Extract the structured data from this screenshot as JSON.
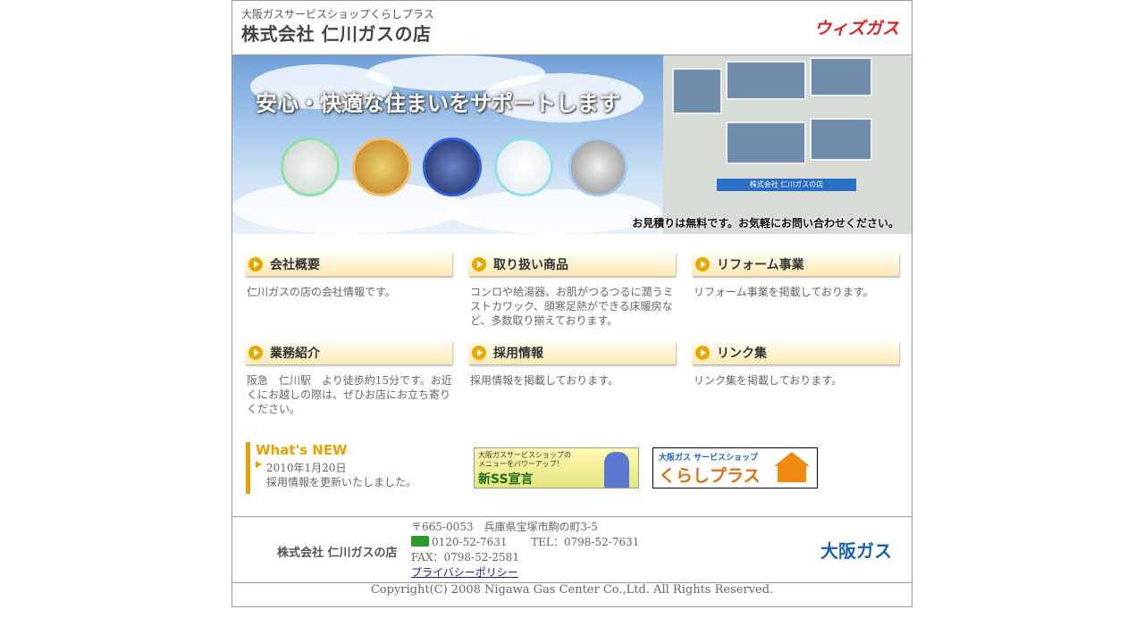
{
  "header": {
    "subtitle": "大阪ガスサービスショップくらしプラス",
    "title": "株式会社 仁川ガスの店",
    "brand": "ウィズガス"
  },
  "hero": {
    "headline": "安心・快適な住まいをサポートします",
    "caption": "お見積りは無料です。お気軽にお問い合わせください。",
    "shop_sign": "株式会社 仁川ガスの店"
  },
  "menu": [
    {
      "label": "会社概要",
      "desc": "仁川ガスの店の会社情報です。"
    },
    {
      "label": "取り扱い商品",
      "desc": "コンロや給湯器、お肌がつるつるに潤うミストカワック、頭寒足熱ができる床暖房など、多数取り揃えております。"
    },
    {
      "label": "リフォーム事業",
      "desc": "リフォーム事業を掲載しております。"
    },
    {
      "label": "業務紹介",
      "desc": "阪急　仁川駅　より徒歩約15分です。お近くにお越しの際は、ぜひお店にお立ち寄りください。"
    },
    {
      "label": "採用情報",
      "desc": "採用情報を掲載しております。"
    },
    {
      "label": "リンク集",
      "desc": "リンク集を掲載しております。"
    }
  ],
  "news": {
    "title": "What's NEW",
    "date": "2010年1月20日",
    "text": "採用情報を更新いたしました。"
  },
  "banners": {
    "ss": {
      "line1": "大阪ガスサービスショップの",
      "line2": "メニューをパワーアップ！",
      "line3": "新SS宣言"
    },
    "kurashi": {
      "line1": "大阪ガス サービスショップ",
      "line2": "くらしプラス"
    }
  },
  "footer": {
    "company": "株式会社 仁川ガスの店",
    "address": "〒665-0053　兵庫県宝塚市駒の町3-5",
    "freedial": "0120-52-7631",
    "tel": "TEL：0798-52-7631",
    "fax": "FAX：0798-52-2581",
    "privacy": "プライバシーポリシー",
    "logo": "大阪ガス"
  },
  "copyright": "Copyright(C) 2008 Nigawa Gas Center Co.,Ltd. All Rights Reserved."
}
